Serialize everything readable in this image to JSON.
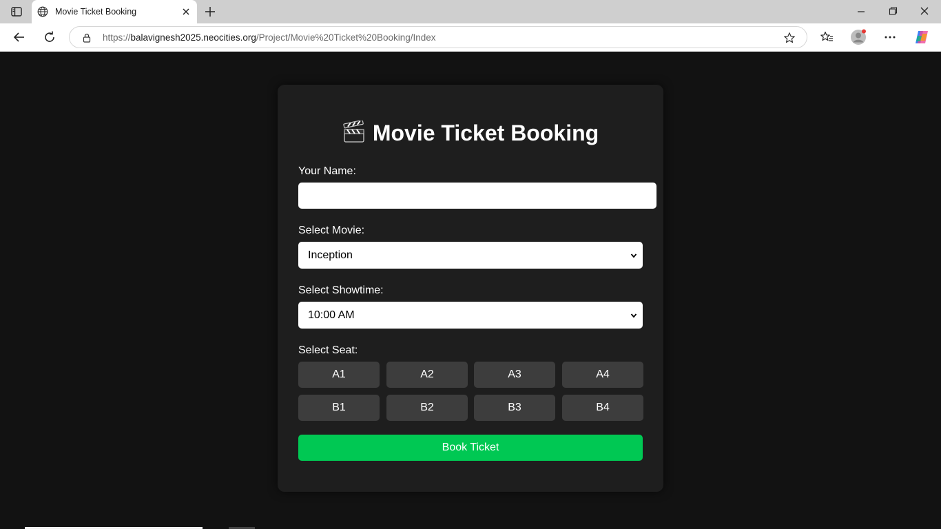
{
  "browser": {
    "tab_title": "Movie Ticket Booking",
    "url_prefix": "https://",
    "url_host": "balavignesh2025.neocities.org",
    "url_path": "/Project/Movie%20Ticket%20Booking/Index"
  },
  "page": {
    "title": "Movie Ticket Booking",
    "name_label": "Your Name:",
    "name_value": "",
    "movie_label": "Select Movie:",
    "movie_selected": "Inception",
    "showtime_label": "Select Showtime:",
    "showtime_selected": "10:00 AM",
    "seat_label": "Select Seat:",
    "seats": [
      "A1",
      "A2",
      "A3",
      "A4",
      "B1",
      "B2",
      "B3",
      "B4"
    ],
    "book_button": "Book Ticket"
  },
  "colors": {
    "background": "#121212",
    "card": "#1e1e1e",
    "seat": "#3d3d3d",
    "accent": "#00c853"
  },
  "icons": [
    "tab-sidebar-icon",
    "globe-icon",
    "close-icon",
    "plus-icon",
    "minimize-icon",
    "restore-icon",
    "back-icon",
    "reload-icon",
    "lock-icon",
    "star-icon",
    "favorites-icon",
    "profile-icon",
    "more-icon",
    "copilot-icon",
    "clapperboard-icon"
  ]
}
